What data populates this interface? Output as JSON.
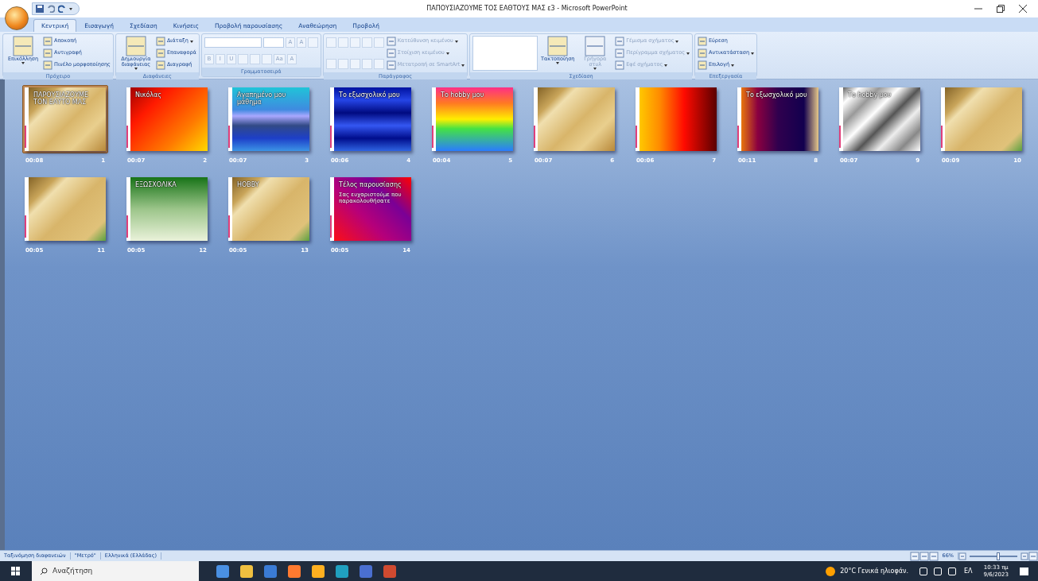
{
  "window": {
    "title": "ΠΑΠΟΥΣΙΑΖΟΥΜΕ ΤΟΣ ΕΑΘΤΟΥΣ ΜΑΣ ε3 - Microsoft PowerPoint"
  },
  "tabs": [
    {
      "label": "Κεντρική",
      "selected": true
    },
    {
      "label": "Εισαγωγή",
      "selected": false
    },
    {
      "label": "Σχεδίαση",
      "selected": false
    },
    {
      "label": "Κινήσεις",
      "selected": false
    },
    {
      "label": "Προβολή παρουσίασης",
      "selected": false
    },
    {
      "label": "Αναθεώρηση",
      "selected": false
    },
    {
      "label": "Προβολή",
      "selected": false
    }
  ],
  "groups": [
    {
      "caption": "Πρόχειρο",
      "columns": [
        {
          "kind": "large",
          "label": "Επικόλληση",
          "disabled": false,
          "dropdown": true
        },
        {
          "kind": "stack",
          "items": [
            {
              "kind": "small",
              "label": "Αποκοπή",
              "disabled": false,
              "dropdown": false
            },
            {
              "kind": "small",
              "label": "Αντιγραφή",
              "disabled": false,
              "dropdown": false
            },
            {
              "kind": "small",
              "label": "Πινέλο μορφοποίησης",
              "disabled": false,
              "dropdown": false
            }
          ]
        }
      ]
    },
    {
      "caption": "Διαφάνειες",
      "columns": [
        {
          "kind": "large",
          "label": "Δημιουργία διαφάνειας",
          "disabled": false,
          "dropdown": true
        },
        {
          "kind": "stack",
          "items": [
            {
              "kind": "small",
              "label": "Διάταξη",
              "disabled": false,
              "dropdown": true
            },
            {
              "kind": "small",
              "label": "Επαναφορά",
              "disabled": false,
              "dropdown": false
            },
            {
              "kind": "small",
              "label": "Διαγραφή",
              "disabled": false,
              "dropdown": false
            }
          ]
        }
      ]
    },
    {
      "caption": "Γραμματοσειρά",
      "columns": [
        {
          "kind": "stack",
          "items": [
            {
              "kind": "tools",
              "disabled": true,
              "parts": [
                {
                  "kind": "field"
                },
                {
                  "kind": "smallfield"
                },
                {
                  "kind": "glyph",
                  "text": "A"
                },
                {
                  "kind": "glyph",
                  "text": "A"
                },
                {
                  "kind": "icon"
                }
              ]
            },
            {
              "kind": "tools",
              "disabled": true,
              "parts": [
                {
                  "kind": "glyph",
                  "text": "B"
                },
                {
                  "kind": "glyph",
                  "text": "I"
                },
                {
                  "kind": "glyph",
                  "text": "U"
                },
                {
                  "kind": "icon"
                },
                {
                  "kind": "icon"
                },
                {
                  "kind": "icon"
                },
                {
                  "kind": "glyph",
                  "text": "Aa"
                },
                {
                  "kind": "glyph",
                  "text": "A"
                }
              ]
            }
          ]
        }
      ]
    },
    {
      "caption": "Παράγραφος",
      "columns": [
        {
          "kind": "stack",
          "items": [
            {
              "kind": "tools",
              "disabled": true,
              "parts": [
                {
                  "kind": "icon"
                },
                {
                  "kind": "icon"
                },
                {
                  "kind": "icon"
                },
                {
                  "kind": "icon"
                },
                {
                  "kind": "icon"
                }
              ]
            },
            {
              "kind": "tools",
              "disabled": true,
              "parts": [
                {
                  "kind": "icon"
                },
                {
                  "kind": "icon"
                },
                {
                  "kind": "icon"
                },
                {
                  "kind": "icon"
                },
                {
                  "kind": "icon"
                }
              ]
            }
          ]
        },
        {
          "kind": "stack",
          "items": [
            {
              "kind": "small",
              "label": "Κατεύθυνση κειμένου",
              "disabled": true,
              "dropdown": true
            },
            {
              "kind": "small",
              "label": "Στοίχιση κειμένου",
              "disabled": true,
              "dropdown": true
            },
            {
              "kind": "small",
              "label": "Μετατροπή σε SmartArt",
              "disabled": true,
              "dropdown": true
            }
          ]
        }
      ]
    },
    {
      "caption": "Σχεδίαση",
      "columns": [
        {
          "kind": "shapes"
        },
        {
          "kind": "large",
          "label": "Τακτοποίηση",
          "disabled": false,
          "dropdown": true
        },
        {
          "kind": "large",
          "label": "Γρήγορα στυλ",
          "disabled": true,
          "dropdown": true
        },
        {
          "kind": "stack",
          "items": [
            {
              "kind": "small",
              "label": "Γέμισμα σχήματος",
              "disabled": true,
              "dropdown": true
            },
            {
              "kind": "small",
              "label": "Περίγραμμα σχήματος",
              "disabled": true,
              "dropdown": true
            },
            {
              "kind": "small",
              "label": "Εφέ σχήματος",
              "disabled": true,
              "dropdown": true
            }
          ]
        }
      ]
    },
    {
      "caption": "Επεξεργασία",
      "columns": [
        {
          "kind": "stack",
          "items": [
            {
              "kind": "small",
              "label": "Εύρεση",
              "disabled": false,
              "dropdown": false
            },
            {
              "kind": "small",
              "label": "Αντικατάσταση",
              "disabled": false,
              "dropdown": true
            },
            {
              "kind": "small",
              "label": "Επιλογή",
              "disabled": false,
              "dropdown": true
            }
          ]
        }
      ]
    }
  ],
  "slides": [
    {
      "number": "1",
      "time": "00:08",
      "selected": true,
      "kind": "gold",
      "title": "ΠΑΡΟΥΣΙΑΖΟΥΜΕ ΤΟΝ ΕΑΥΤΟ ΜΑΣ"
    },
    {
      "number": "2",
      "time": "00:07",
      "selected": false,
      "kind": "redorange",
      "title": "Νικόλας"
    },
    {
      "number": "3",
      "time": "00:07",
      "selected": false,
      "kind": "bluestripe",
      "title": "Αγαπημένο μου μάθημα"
    },
    {
      "number": "4",
      "time": "00:06",
      "selected": false,
      "kind": "navy",
      "title": "Το εξωσχολικό μου"
    },
    {
      "number": "5",
      "time": "00:04",
      "selected": false,
      "kind": "rainbow",
      "title": "Το hobby μου"
    },
    {
      "number": "6",
      "time": "00:07",
      "selected": false,
      "kind": "gold"
    },
    {
      "number": "7",
      "time": "00:06",
      "selected": false,
      "kind": "sunset"
    },
    {
      "number": "8",
      "time": "00:11",
      "selected": false,
      "kind": "dusk",
      "title": "Το εξωσχολικό μου"
    },
    {
      "number": "9",
      "time": "00:07",
      "selected": false,
      "kind": "silver",
      "title": "Το hobby μου"
    },
    {
      "number": "10",
      "time": "00:09",
      "selected": false,
      "kind": "goldgreen"
    },
    {
      "number": "11",
      "time": "00:05",
      "selected": false,
      "kind": "goldgreen"
    },
    {
      "number": "12",
      "time": "00:05",
      "selected": false,
      "kind": "green",
      "title": "ΕΞΩΣΧΟΛΙΚΑ"
    },
    {
      "number": "13",
      "time": "00:05",
      "selected": false,
      "kind": "goldgreen",
      "title": "HOBBY"
    },
    {
      "number": "14",
      "time": "00:05",
      "selected": false,
      "kind": "magenta",
      "title": "Τέλος παρουσίασης",
      "body": "Σας ευχαριστούμε που παρακολουθήσατε"
    }
  ],
  "status_bar": {
    "items": [
      "Ταξινόμηση διαφανειών",
      "\"Μετρό\"",
      "Ελληνικά (Ελλάδας)"
    ],
    "zoom": "66%",
    "zoom_slider": {
      "level": 0.62
    }
  },
  "taskbar": {
    "search_placeholder": "Αναζήτηση",
    "weather": "20°C Γενικά ηλιοφάν.",
    "language": "ΕΛ",
    "time": "10:33 πμ",
    "date": "9/6/2023"
  }
}
